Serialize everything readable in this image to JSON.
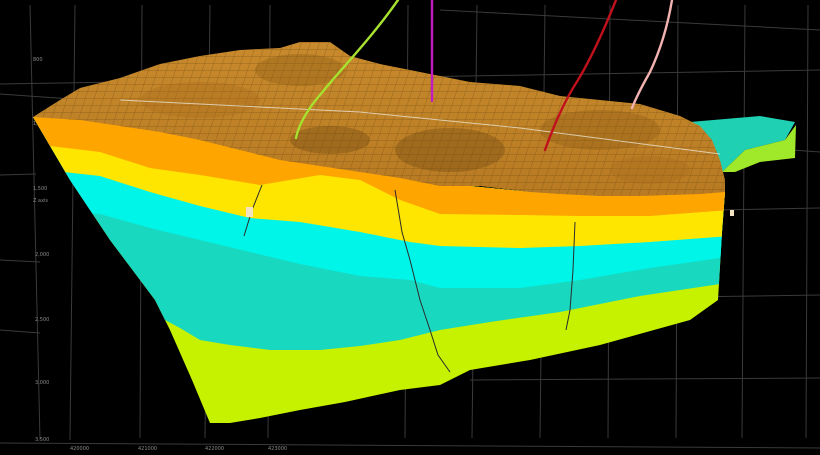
{
  "viewport": {
    "background": "#000000",
    "grid_color": "#3a3a3a"
  },
  "model": {
    "layers": [
      {
        "name": "",
        "color": "#FFA500"
      },
      {
        "name": "",
        "color": "#FFE600"
      },
      {
        "name": "",
        "color": "#00F5E9"
      },
      {
        "name": "",
        "color": "#19D8C0"
      },
      {
        "name": "",
        "color": "#C6F200"
      }
    ],
    "top_surface_color": "#D4932E",
    "side_panel_colors": [
      "#1FD0B2",
      "#9FE82A"
    ]
  },
  "wells": [
    {
      "name": "",
      "color": "#A6E22E"
    },
    {
      "name": "",
      "color": "#C21BC2"
    },
    {
      "name": "",
      "color": "#C0111C"
    },
    {
      "name": "",
      "color": "#F2B3B0"
    }
  ],
  "axes": {
    "z_ticks": [
      "800",
      "1,000",
      "Z axis",
      "1,500",
      "2,000",
      "2,500",
      "3,000",
      "3,500"
    ],
    "x_ticks": [
      "420000",
      "421000",
      "422000",
      "423000"
    ]
  }
}
